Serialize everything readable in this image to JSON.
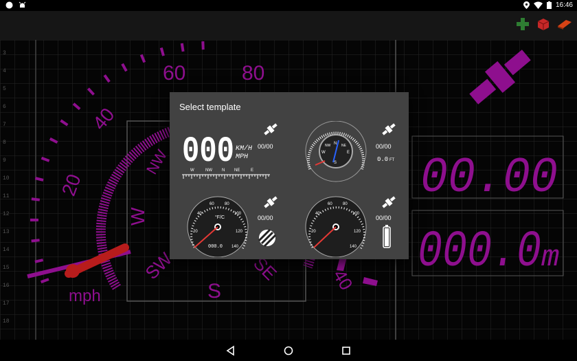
{
  "status_bar": {
    "time": "16:46",
    "left_icons": [
      "circle-icon",
      "android-debug-icon"
    ],
    "right_icons": [
      "location-icon",
      "wifi-icon",
      "battery-icon"
    ]
  },
  "action_bar": {
    "actions": [
      {
        "name": "add-button",
        "icon": "plus-icon",
        "color": "#2e7d32"
      },
      {
        "name": "layouts-button",
        "icon": "cube-icon",
        "color": "#c62828"
      },
      {
        "name": "eraser-button",
        "icon": "eraser-icon",
        "color": "#d84315"
      }
    ]
  },
  "background": {
    "accent_color": "#8e0f8e",
    "row_numbers": [
      "3",
      "4",
      "5",
      "6",
      "7",
      "8",
      "9",
      "10",
      "11",
      "12",
      "13",
      "14",
      "15",
      "16",
      "17",
      "18"
    ],
    "speed_labels": [
      "20",
      "40",
      "60",
      "80"
    ],
    "compass_labels": [
      "NW",
      "W",
      "SW",
      "S",
      "SE"
    ],
    "right_speed_label": "40",
    "unit_label": "mph",
    "digital_top": "00.00",
    "digital_bottom": "000.0",
    "digital_bottom_unit": "m"
  },
  "dialog": {
    "title": "Select template",
    "templates": [
      {
        "name": "digital-template",
        "speed": "000",
        "unit_top": "KM/H",
        "unit_bottom": "MPH",
        "sats": "00/00",
        "compass": [
          "W",
          "NW",
          "N",
          "NE",
          "E"
        ]
      },
      {
        "name": "compass-gauge-template",
        "sats": "00/00",
        "altitude": "0.0",
        "altitude_unit": "FT",
        "compass": [
          "N",
          "NE",
          "E",
          "S",
          "W",
          "NW"
        ]
      },
      {
        "name": "temperature-gauge-template",
        "sats": "00/00",
        "temp_unit": "°F/C",
        "odo": "000.0",
        "ticks": [
          "20",
          "40",
          "60",
          "80",
          "100",
          "120",
          "140"
        ]
      },
      {
        "name": "battery-gauge-template",
        "sats": "00/00",
        "ticks": [
          "20",
          "40",
          "60",
          "80",
          "100",
          "120",
          "140"
        ]
      }
    ]
  }
}
